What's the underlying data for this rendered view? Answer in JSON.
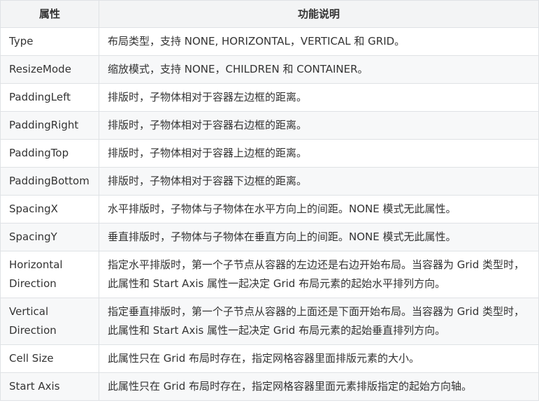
{
  "table": {
    "headers": [
      "属性",
      "功能说明"
    ],
    "rows": [
      {
        "name": "Type",
        "desc": "布局类型，支持 NONE, HORIZONTAL，VERTICAL 和 GRID。"
      },
      {
        "name": "ResizeMode",
        "desc": "缩放模式，支持 NONE，CHILDREN 和 CONTAINER。"
      },
      {
        "name": "PaddingLeft",
        "desc": "排版时，子物体相对于容器左边框的距离。"
      },
      {
        "name": "PaddingRight",
        "desc": "排版时，子物体相对于容器右边框的距离。"
      },
      {
        "name": "PaddingTop",
        "desc": "排版时，子物体相对于容器上边框的距离。"
      },
      {
        "name": "PaddingBottom",
        "desc": "排版时，子物体相对于容器下边框的距离。"
      },
      {
        "name": "SpacingX",
        "desc": "水平排版时，子物体与子物体在水平方向上的间距。NONE 模式无此属性。"
      },
      {
        "name": "SpacingY",
        "desc": "垂直排版时，子物体与子物体在垂直方向上的间距。NONE 模式无此属性。"
      },
      {
        "name": "Horizontal Direction",
        "desc": "指定水平排版时，第一个子节点从容器的左边还是右边开始布局。当容器为 Grid 类型时，此属性和 Start Axis 属性一起决定 Grid 布局元素的起始水平排列方向。"
      },
      {
        "name": "Vertical Direction",
        "desc": "指定垂直排版时，第一个子节点从容器的上面还是下面开始布局。当容器为 Grid 类型时，此属性和 Start Axis 属性一起决定 Grid 布局元素的起始垂直排列方向。"
      },
      {
        "name": "Cell Size",
        "desc": "此属性只在 Grid 布局时存在，指定网格容器里面排版元素的大小。"
      },
      {
        "name": "Start Axis",
        "desc": "此属性只在 Grid 布局时存在，指定网格容器里面元素排版指定的起始方向轴。"
      }
    ]
  }
}
